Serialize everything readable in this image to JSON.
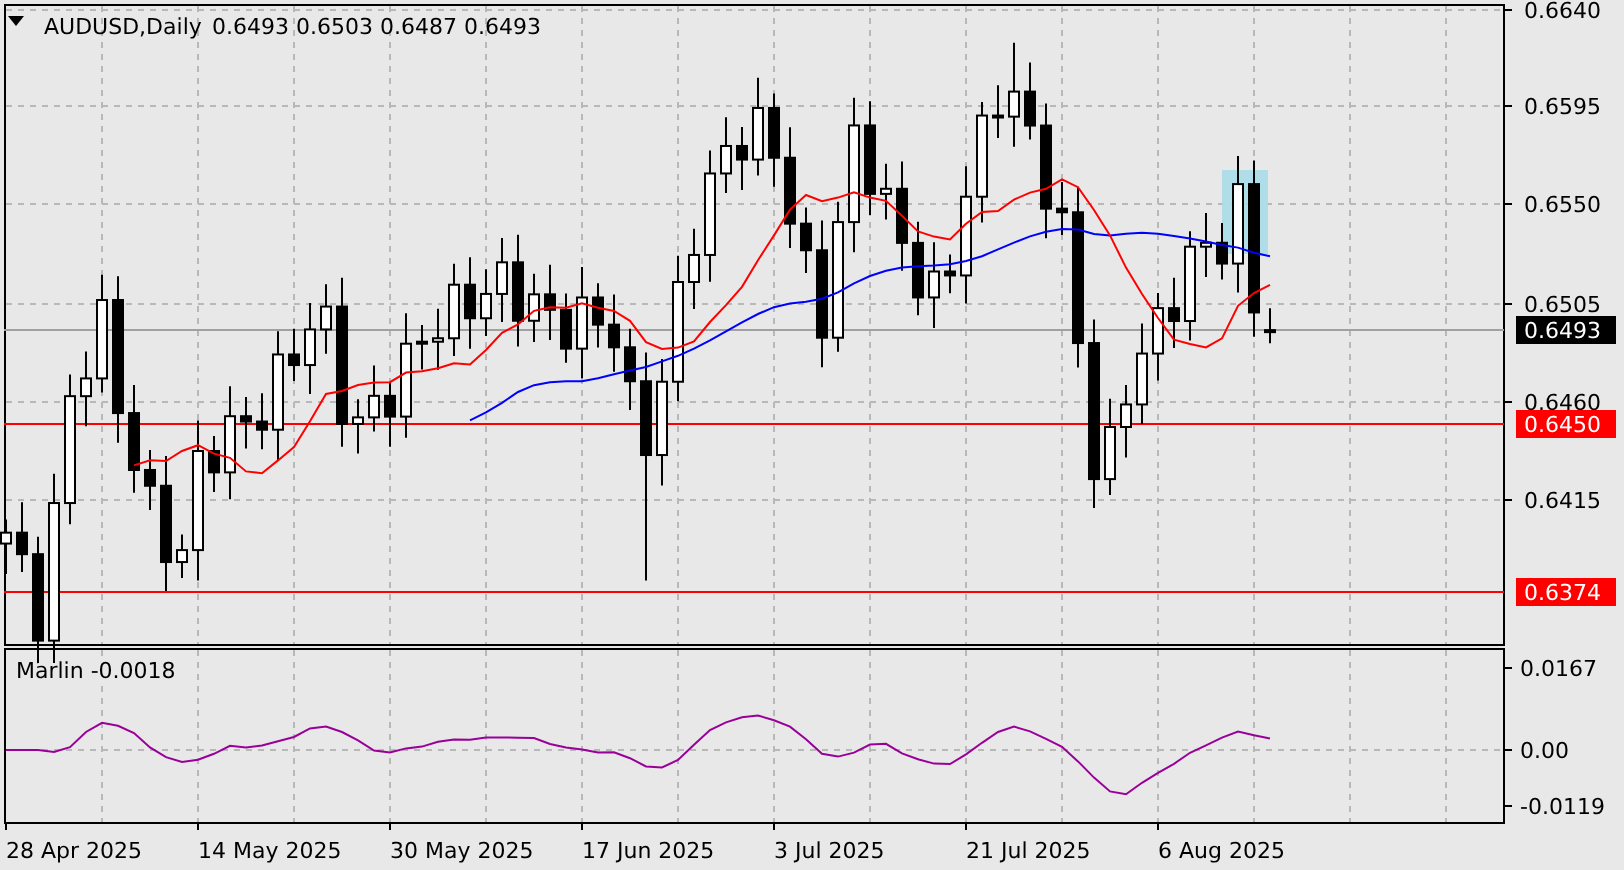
{
  "header": {
    "symbol": "AUDUSD,Daily",
    "ohlc": [
      "0.6493",
      "0.6503",
      "0.6487",
      "0.6493"
    ]
  },
  "price_axis": {
    "ticks": [
      "0.6640",
      "0.6595",
      "0.6550",
      "0.6505",
      "0.6460",
      "0.6415"
    ]
  },
  "price_labels": [
    {
      "text": "0.6493",
      "kind": "current"
    },
    {
      "text": "0.6450",
      "kind": "level"
    },
    {
      "text": "0.6374",
      "kind": "level"
    }
  ],
  "indicator": {
    "label": "Marlin -0.0018",
    "ticks": [
      "0.0167",
      "0.00",
      "-0.0119"
    ]
  },
  "date_axis": [
    "28 Apr 2025",
    "14 May 2025",
    "30 May 2025",
    "17 Jun 2025",
    "3 Jul 2025",
    "21 Jul 2025",
    "6 Aug 2025"
  ]
}
